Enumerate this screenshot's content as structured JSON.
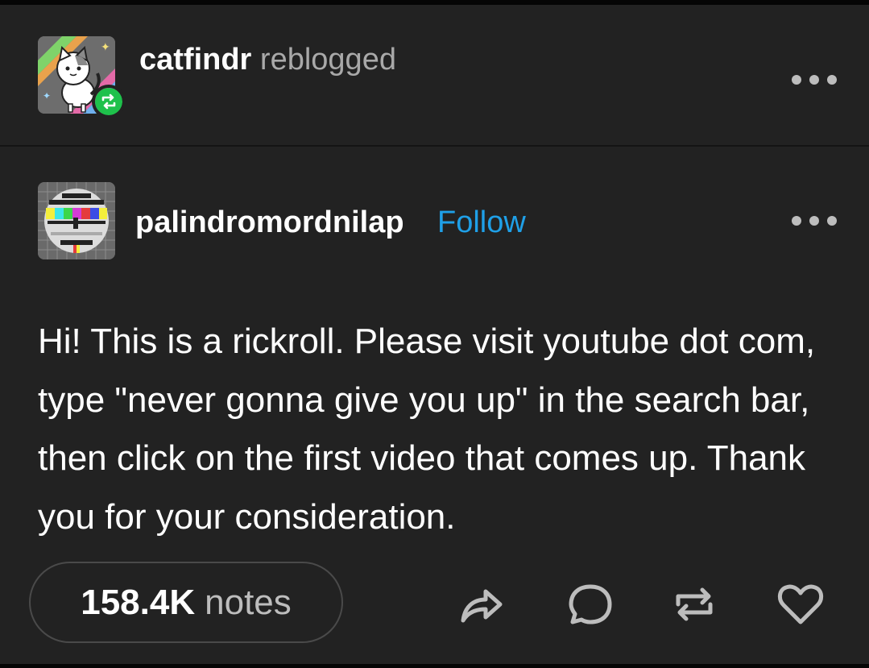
{
  "reblog_header": {
    "reblogger": "catfindr",
    "action_text": "reblogged",
    "badge_color": "#1ec14b"
  },
  "post": {
    "author": "palindromordnilap",
    "follow_label": "Follow",
    "body": "Hi! This is a rickroll. Please visit youtube dot com, type \"never gonna give you up\" in the search bar, then click on the first video that comes up. Thank you for your consideration."
  },
  "footer": {
    "notes_count": "158.4K",
    "notes_label": "notes",
    "actions": [
      "share-icon",
      "reply-icon",
      "reblog-icon",
      "like-icon"
    ]
  },
  "colors": {
    "background": "#222222",
    "accent_link": "#1fa0e8",
    "muted_text": "#a9a9a9"
  }
}
